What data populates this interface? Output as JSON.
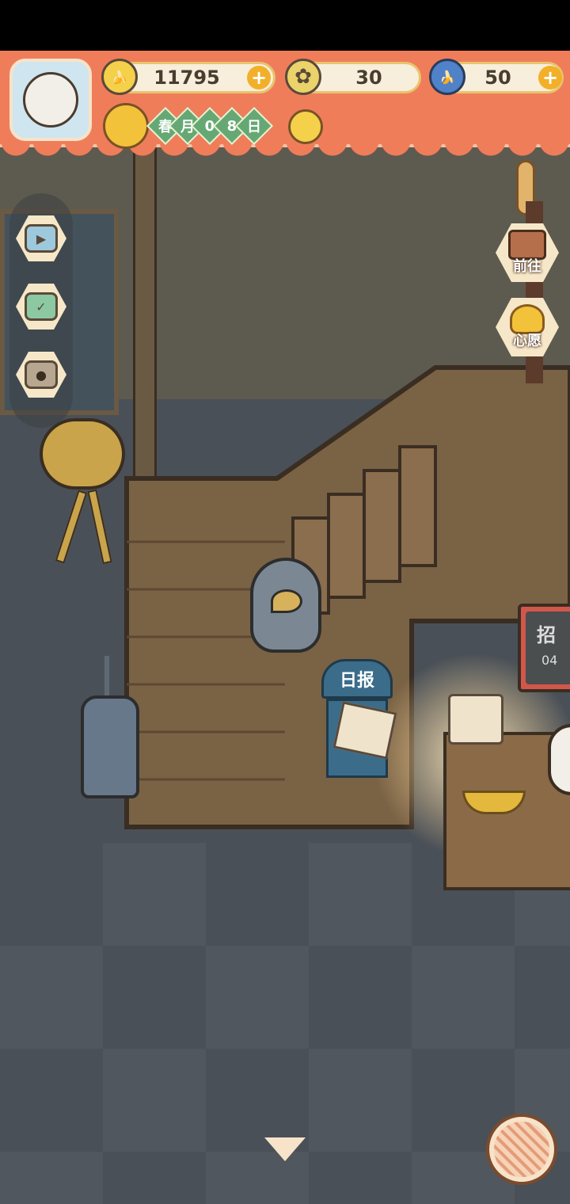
{
  "resources": {
    "banana": {
      "value": "11795",
      "icon": "banana-icon"
    },
    "clover": {
      "value": "30",
      "icon": "clover-icon"
    },
    "blue_banana": {
      "value": "50",
      "icon": "blue-banana-icon"
    }
  },
  "date": {
    "season": "春",
    "month_label": "月",
    "day_digit1": "0",
    "day_digit2": "8",
    "day_label": "日"
  },
  "right_buttons": {
    "goto_label": "前往",
    "wish_label": "心愿"
  },
  "scene": {
    "newspaper_sign": "日报",
    "board_text": "招",
    "board_sub": "04"
  },
  "colors": {
    "header": "#f07d5a",
    "resource_bg": "#f7eedb",
    "plus": "#f2b02a",
    "date_green": "#66a874"
  }
}
